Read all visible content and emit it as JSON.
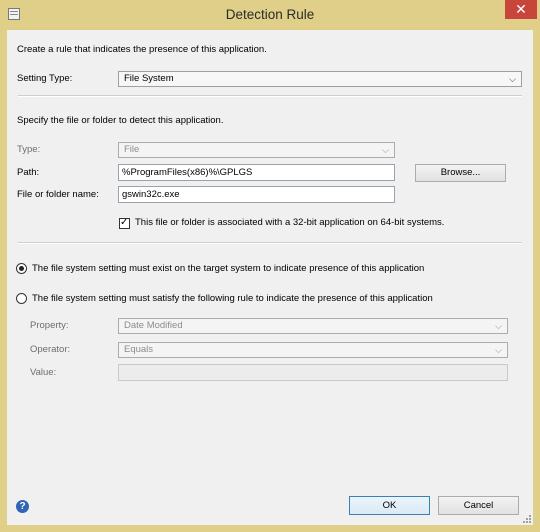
{
  "window": {
    "title": "Detection Rule",
    "close_glyph": "✕"
  },
  "intro": "Create a rule that indicates the presence of this application.",
  "setting_type": {
    "label": "Setting Type:",
    "value": "File System"
  },
  "file_section": {
    "instruction": "Specify the file or folder to detect this application.",
    "type_label": "Type:",
    "type_value": "File",
    "path_label": "Path:",
    "path_value": "%ProgramFiles(x86)%\\GPLGS",
    "browse_label": "Browse...",
    "name_label": "File or folder name:",
    "name_value": "gswin32c.exe",
    "checkbox_label": "This file or folder is associated with a 32-bit application on 64-bit systems.",
    "checkbox_checked": true
  },
  "options": {
    "exist_label": "The file system setting must exist on the target system to indicate presence of this application",
    "exist_selected": true,
    "rule_label": "The file system setting must satisfy the following rule to indicate the presence of this application",
    "rule_selected": false
  },
  "rule": {
    "property_label": "Property:",
    "property_value": "Date Modified",
    "operator_label": "Operator:",
    "operator_value": "Equals",
    "value_label": "Value:",
    "value_value": ""
  },
  "footer": {
    "help_glyph": "?",
    "ok_label": "OK",
    "cancel_label": "Cancel"
  },
  "icons": {
    "chevron": "⌄"
  }
}
